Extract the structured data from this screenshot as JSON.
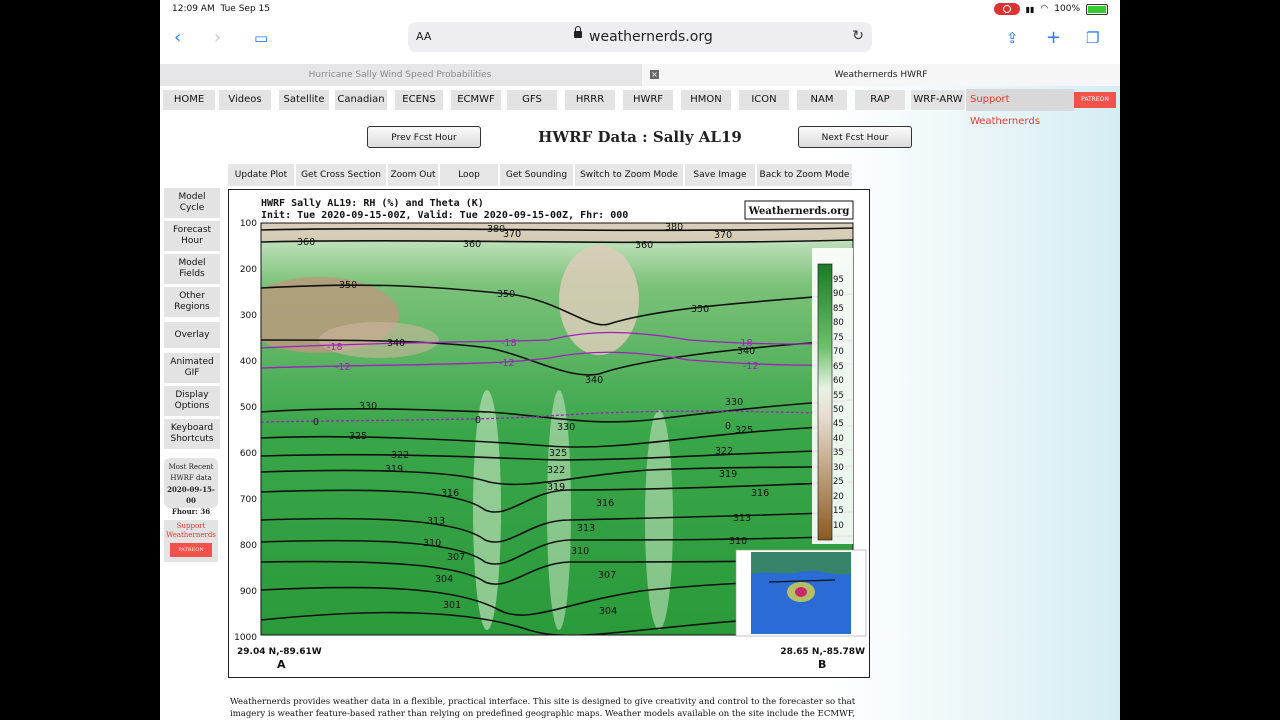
{
  "status_bar": {
    "time": "12:09 AM",
    "date": "Tue Sep 15",
    "battery": "100%"
  },
  "browser": {
    "aa_label": "AA",
    "domain": "weathernerds.org",
    "tabs": [
      {
        "label": "Hurricane Sally Wind Speed Probabilities",
        "active": false
      },
      {
        "label": "Weathernerds HWRF",
        "active": true
      }
    ]
  },
  "nav": {
    "items": [
      "HOME",
      "Videos",
      "Satellite",
      "Canadian",
      "ECENS",
      "ECMWF",
      "GFS",
      "HRRR",
      "HWRF",
      "HMON",
      "ICON",
      "NAM",
      "RAP",
      "WRF-ARW"
    ],
    "support_label": "Support Weathernerds",
    "patreon_label": "PATREON"
  },
  "page": {
    "title": "HWRF Data : Sally AL19",
    "prev_button": "Prev Fcst Hour",
    "next_button": "Next Fcst Hour"
  },
  "actions": [
    "Update Plot",
    "Get Cross Section",
    "Zoom Out",
    "Loop",
    "Get Sounding",
    "Switch to Zoom Mode",
    "Save Image",
    "Back to Zoom Mode"
  ],
  "sidebar": {
    "items": [
      {
        "line1": "Model",
        "line2": "Cycle"
      },
      {
        "line1": "Forecast",
        "line2": "Hour"
      },
      {
        "line1": "Model",
        "line2": "Fields"
      },
      {
        "line1": "Other",
        "line2": "Regions"
      },
      {
        "line1": "Overlay",
        "line2": ""
      },
      {
        "line1": "Animated",
        "line2": "GIF"
      },
      {
        "line1": "Display",
        "line2": "Options"
      },
      {
        "line1": "Keyboard",
        "line2": "Shortcuts"
      }
    ],
    "recent": {
      "line1": "Most Recent",
      "line2": "HWRF data",
      "line3": "2020-09-15-00",
      "line4": "Fhour: 36"
    },
    "support": {
      "line1": "Support",
      "line2": "Weathernerds",
      "patreon": "PATREON"
    }
  },
  "plot": {
    "title_line1": "HWRF Sally AL19: RH (%) and Theta (K)",
    "title_line2": "Init: Tue 2020-09-15-00Z, Valid: Tue 2020-09-15-00Z, Fhr: 000",
    "watermark": "Weathernerds.org",
    "y_ticks": [
      "100",
      "200",
      "300",
      "400",
      "500",
      "600",
      "700",
      "800",
      "900",
      "1000"
    ],
    "colorbar_ticks": [
      "95",
      "90",
      "85",
      "80",
      "75",
      "70",
      "65",
      "60",
      "55",
      "50",
      "45",
      "40",
      "35",
      "30",
      "25",
      "20",
      "15",
      "10"
    ],
    "start_label": "29.04 N,-89.61W",
    "end_label": "28.65 N,-85.78W",
    "point_a": "A",
    "point_b": "B",
    "theta_labels": [
      "380",
      "370",
      "360",
      "350",
      "340",
      "330",
      "325",
      "322",
      "319",
      "316",
      "313",
      "310",
      "307",
      "304",
      "301"
    ],
    "temp_labels": [
      "-18",
      "-12",
      "0"
    ],
    "colors": {
      "moist": "#1f9a2e",
      "dry": "#b89a7c",
      "theta_line": "#111111",
      "temp_line": "#a020c0"
    }
  },
  "footer": {
    "text": "Weathernerds provides weather data in a flexible, practical interface. This site is designed to give creativity and control to the forecaster so that imagery is weather feature-based rather than relying on predefined geographic maps. Weather models available on the site include the ECMWF, GEM, GFS,"
  }
}
